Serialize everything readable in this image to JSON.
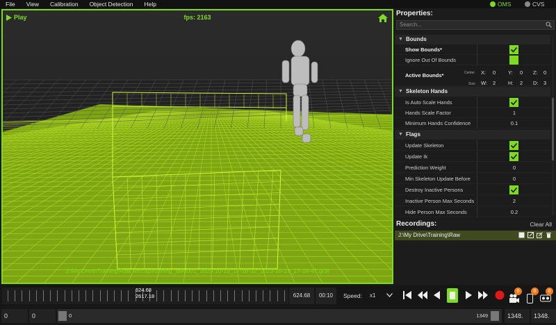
{
  "menu": [
    "File",
    "View",
    "Calibration",
    "Object Detection",
    "Help"
  ],
  "modes": [
    {
      "label": "OMS",
      "color": "#7ddc1f"
    },
    {
      "label": "CVS",
      "color": "#888888"
    }
  ],
  "viewport": {
    "play_label": "Play",
    "fps": "fps: 2163",
    "path": "J:\\My Drive\\Training\\Raw Mocap\\running_take001_2023-10-19_17-16-32_2023-10-19_17-16-47.gr3t",
    "accent": "#7ddc1f"
  },
  "properties": {
    "title": "Properties:",
    "search_placeholder": "Search...",
    "bounds": {
      "header": "Bounds",
      "show_bounds": "Show Bounds*",
      "ignore_out": "Ignore Out Of Bounds",
      "active_bounds": "Active Bounds*",
      "center_label": "Center",
      "size_label": "Size",
      "cx": "X:",
      "cx_val": "0",
      "cy": "Y:",
      "cy_val": "0",
      "cz": "Z:",
      "cz_val": "0",
      "sw": "W:",
      "sw_val": "2",
      "sh": "H:",
      "sh_val": "2",
      "sd": "D:",
      "sd_val": "3"
    },
    "skeleton_hands": {
      "header": "Skeleton Hands",
      "auto_scale": "Is Auto Scale Hands",
      "scale_factor": "Hands Scale Factor",
      "scale_factor_val": "1",
      "min_conf": "Minimum Hands Confidence",
      "min_conf_val": "0.1"
    },
    "flags": {
      "header": "Flags",
      "update_skeleton": "Update Skeleton",
      "update_ik": "Update Ik",
      "prediction_weight": "Prediction Weight",
      "prediction_weight_val": "0",
      "min_skel_update": "Min Skeleton Update Before",
      "min_skel_update_val": "0",
      "destroy_inactive": "Destroy Inactive Persons",
      "inactive_max": "Inactive Person Max Seconds",
      "inactive_max_val": "2",
      "hide_max": "Hide Person Max Seconds",
      "hide_max_val": "0.2"
    }
  },
  "recordings": {
    "title": "Recordings:",
    "clear_all": "Clear All",
    "items": [
      "J:\\My Drive\\Training\\Raw"
    ]
  },
  "timeline": {
    "marker_top": "624.68",
    "marker_bottom": "2617.18",
    "current_time": "624.68",
    "duration": "00:10",
    "speed_label": "Speed:",
    "speed_value": "x1",
    "badge_counts": [
      "0",
      "0",
      "0"
    ]
  },
  "bottom": {
    "left_a": "0",
    "left_b": "0",
    "slider_start": "0",
    "slider_end": "1349",
    "right_a": "1348.",
    "right_b": "1348."
  }
}
